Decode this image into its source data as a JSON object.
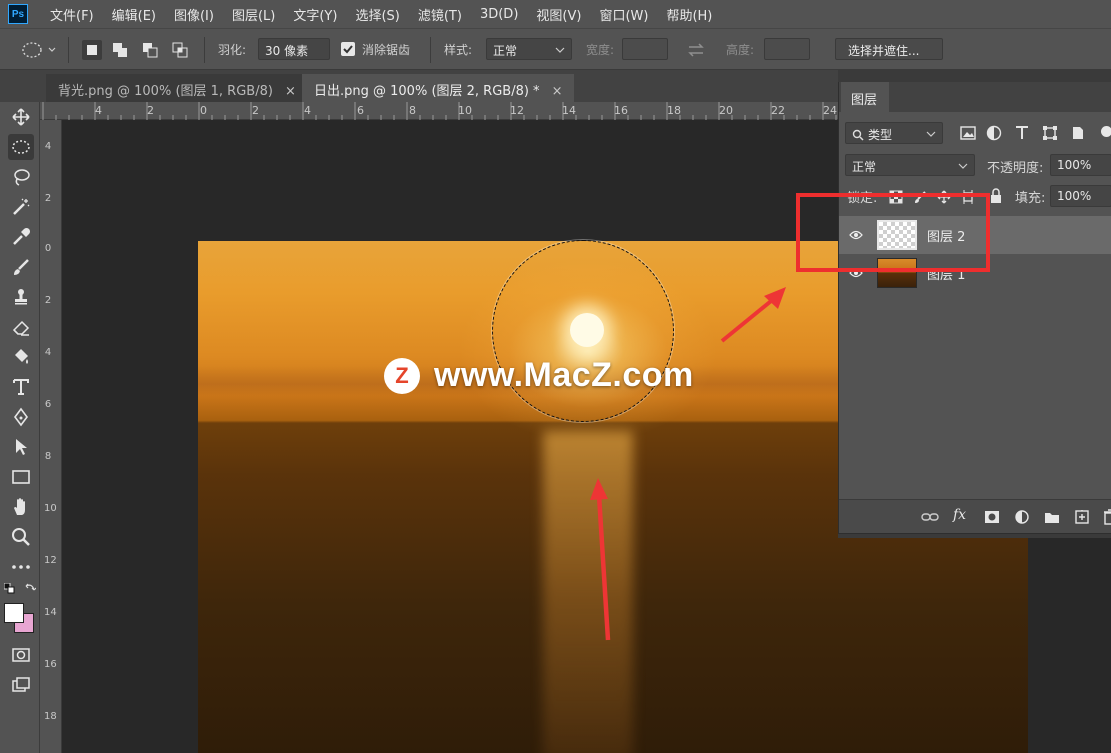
{
  "app": {
    "logo_text": "Ps",
    "menu": [
      "文件(F)",
      "编辑(E)",
      "图像(I)",
      "图层(L)",
      "文字(Y)",
      "选择(S)",
      "滤镜(T)",
      "3D(D)",
      "视图(V)",
      "窗口(W)",
      "帮助(H)"
    ]
  },
  "options": {
    "feather_label": "羽化:",
    "feather_value": "30 像素",
    "antialias_label": "消除锯齿",
    "antialias_checked": true,
    "style_label": "样式:",
    "style_value": "正常",
    "width_label": "宽度:",
    "height_label": "高度:",
    "select_mask_label": "选择并遮住..."
  },
  "tabs": [
    {
      "label": "背光.png @ 100% (图层 1, RGB/8)",
      "close": "×",
      "active": false
    },
    {
      "label": "日出.png @ 100% (图层 2, RGB/8) *",
      "close": "×",
      "active": true
    }
  ],
  "rulers": {
    "top": [
      "4",
      "2",
      "0",
      "2",
      "4",
      "6",
      "8",
      "10",
      "12",
      "14",
      "16",
      "18",
      "20",
      "22",
      "24"
    ],
    "left": [
      "4",
      "2",
      "0",
      "2",
      "4",
      "6",
      "8",
      "10",
      "12",
      "14",
      "16",
      "18"
    ]
  },
  "watermark": {
    "logo": "Z",
    "text": "www.MacZ.com"
  },
  "layers_panel": {
    "tab_label": "图层",
    "filter_label": "类型",
    "blend_mode": "正常",
    "opacity_label": "不透明度:",
    "opacity_value": "100%",
    "lock_label": "锁定:",
    "fill_label": "填充:",
    "fill_value": "100%",
    "layers": [
      {
        "name": "图层 2",
        "visible": true,
        "selected": true
      },
      {
        "name": "图层 1",
        "visible": true,
        "selected": false
      }
    ],
    "footer_icons": [
      "link-icon",
      "fx-icon",
      "mask-icon",
      "adjustment-icon",
      "folder-icon",
      "new-layer-icon",
      "trash-icon"
    ],
    "fx_text": "fx"
  },
  "colors": {
    "foreground": "#ffffff",
    "background": "#e8a6d2",
    "annotation": "#ee2e2e"
  }
}
